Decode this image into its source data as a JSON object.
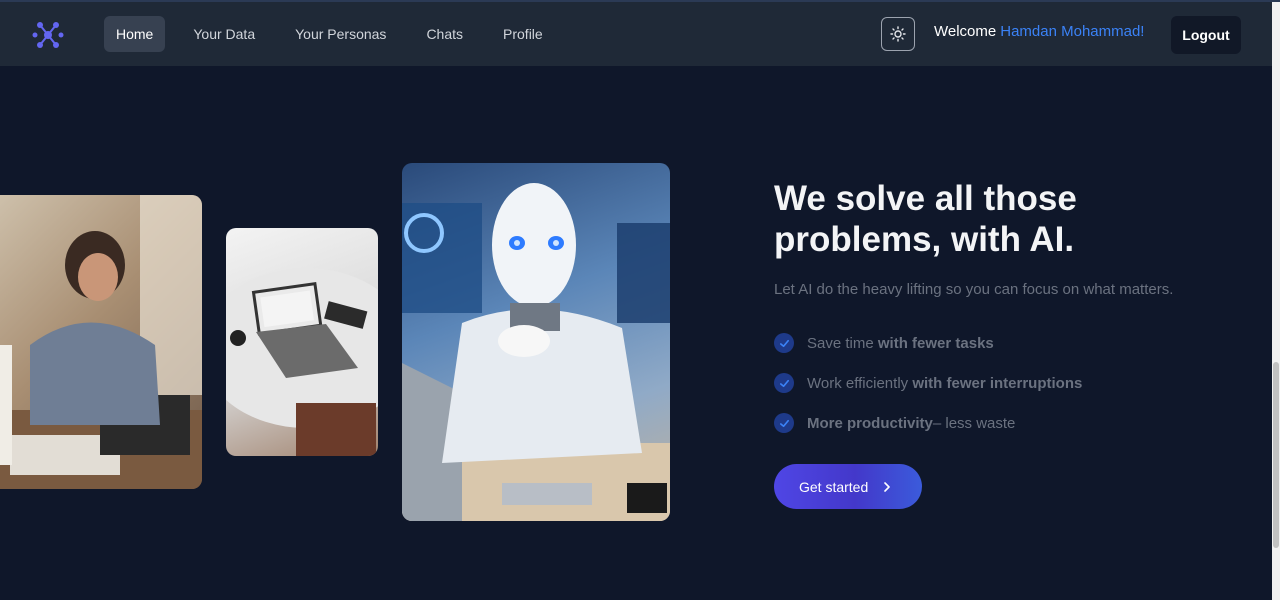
{
  "nav": {
    "links": [
      "Home",
      "Your Data",
      "Your Personas",
      "Chats",
      "Profile"
    ],
    "welcome_prefix": "Welcome",
    "user_name": "Hamdan Mohammad!",
    "logout_label": "Logout"
  },
  "hero": {
    "title_line1": "We solve all those",
    "title_line2": "problems, with AI.",
    "subtitle": "Let AI do the heavy lifting so you can focus on what matters.",
    "features": [
      {
        "plain": "Save time ",
        "bold": "with fewer tasks",
        "suffix": ""
      },
      {
        "plain": "Work efficiently ",
        "bold": "with fewer interruptions",
        "suffix": ""
      },
      {
        "plain": "",
        "bold": "More productivity",
        "suffix": " – less waste"
      }
    ],
    "cta_label": "Get started"
  },
  "colors": {
    "background": "#0f172a",
    "navbar": "#1f2937",
    "accent": "#3b82f6",
    "cta": "#4f46e5"
  },
  "icons": [
    "logo-icon",
    "sun-icon",
    "check-icon",
    "chevron-right-icon"
  ]
}
